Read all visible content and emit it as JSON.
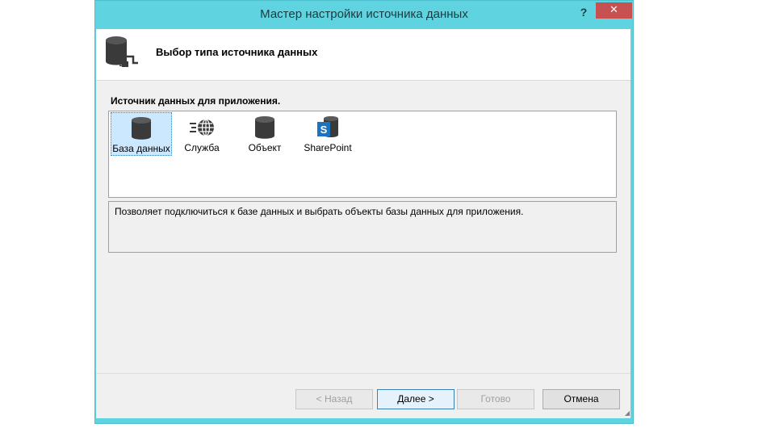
{
  "window": {
    "title": "Мастер настройки источника данных",
    "help_label": "?",
    "close_label": "✕"
  },
  "header": {
    "title": "Выбор типа источника данных",
    "icon": "database-plug-icon"
  },
  "sources": {
    "label": "Источник данных для приложения.",
    "items": [
      {
        "label": "База данных",
        "icon": "database-icon",
        "selected": true
      },
      {
        "label": "Служба",
        "icon": "web-service-icon",
        "selected": false
      },
      {
        "label": "Объект",
        "icon": "object-icon",
        "selected": false
      },
      {
        "label": "SharePoint",
        "icon": "sharepoint-icon",
        "selected": false
      }
    ]
  },
  "description": "Позволяет подключиться к базе данных и выбрать объекты базы данных для приложения.",
  "buttons": {
    "back": "< Назад",
    "next": "Далее >",
    "finish": "Готово",
    "cancel": "Отмена"
  },
  "colors": {
    "titlebar": "#5fd3e0",
    "close": "#c75050",
    "selection": "#cce8ff",
    "sharepoint": "#1e73be"
  }
}
